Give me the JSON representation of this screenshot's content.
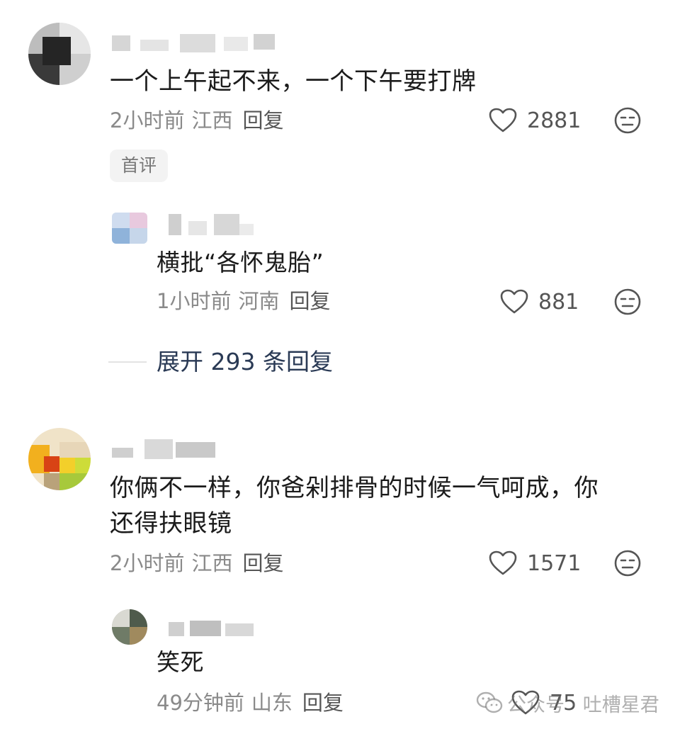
{
  "comments": [
    {
      "text": "一个上午起不来，一个下午要打牌",
      "time": "2小时前",
      "location": "江西",
      "reply_label": "回复",
      "likes": "2881",
      "badge": "首评",
      "reply": {
        "text": "横批“各怀鬼胎”",
        "time": "1小时前",
        "location": "河南",
        "reply_label": "回复",
        "likes": "881"
      },
      "expand_label": "展开 293 条回复"
    },
    {
      "text_line1": "你俩不一样，你爸剁排骨的时候一气呵成，你",
      "text_line2": "还得扶眼镜",
      "time": "2小时前",
      "location": "江西",
      "reply_label": "回复",
      "likes": "1571",
      "reply": {
        "text": "笑死",
        "time": "49分钟前",
        "location": "山东",
        "reply_label": "回复",
        "likes": "75"
      }
    }
  ],
  "icons": {
    "like": "heart-outline-icon",
    "reaction": "neutral-face-icon",
    "watermark": "wechat-icon"
  },
  "watermark": {
    "text": "公众号 · 吐槽星君"
  },
  "colors": {
    "text": "#1b1b1b",
    "meta": "#8a8a8a",
    "expand": "#2a3a55",
    "badge_bg": "#f3f3f3"
  }
}
